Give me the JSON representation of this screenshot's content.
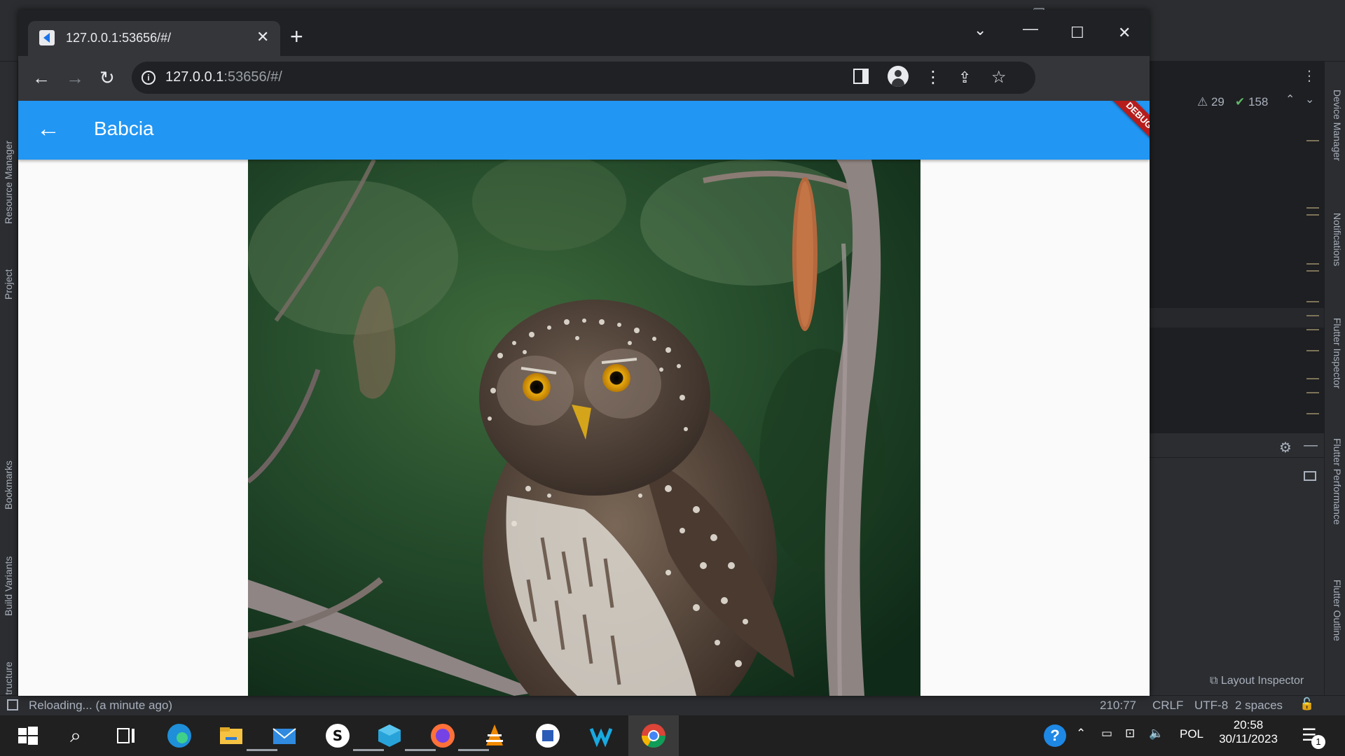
{
  "browser": {
    "tab_title": "127.0.0.1:53656/#/",
    "url_host": "127.0.0.1",
    "url_rest": ":53656/#/"
  },
  "app": {
    "title": "Babcia",
    "debug_banner": "DEBUG",
    "theme_color": "#2196f3"
  },
  "ide": {
    "left_tools": [
      "Resource Manager",
      "Project",
      "Bookmarks",
      "Build Variants",
      "Structure"
    ],
    "right_tools": [
      "Device Manager",
      "Notifications",
      "Flutter Inspector",
      "Flutter Performance",
      "Flutter Outline"
    ],
    "warnings_count": "29",
    "checks_count": "158",
    "layout_inspector_label": "Layout Inspector",
    "status": {
      "message": "Reloading... (a minute ago)",
      "position": "210:77",
      "line_ending": "CRLF",
      "encoding": "UTF-8",
      "indent": "2 spaces"
    }
  },
  "taskbar": {
    "language": "POL",
    "time": "20:58",
    "date": "30/11/2023",
    "notification_count": "1",
    "apps": [
      "start",
      "search",
      "task-view",
      "edge",
      "file-explorer",
      "mail",
      "app-s",
      "box-app",
      "firefox",
      "vlc",
      "word-app",
      "k-app",
      "chrome"
    ]
  }
}
